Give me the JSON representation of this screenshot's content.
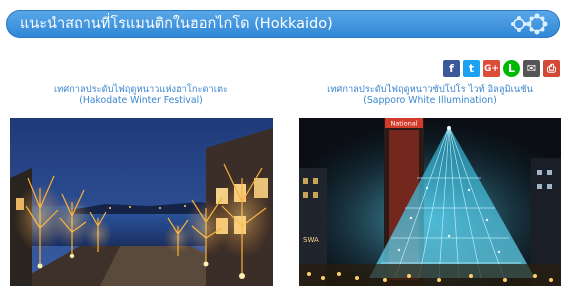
{
  "header": {
    "title": "แนะนำสถานที่โรแมนติกในฮอกไกโด (Hokkaido)",
    "decor_icon": "snowflake-icon"
  },
  "share": {
    "buttons": [
      {
        "name": "facebook",
        "glyph": "f",
        "color": "#3b5998"
      },
      {
        "name": "twitter",
        "glyph": "t",
        "color": "#1da1f2"
      },
      {
        "name": "google-plus",
        "glyph": "G+",
        "color": "#dd4b39"
      },
      {
        "name": "line",
        "glyph": "L",
        "color": "#00b900"
      },
      {
        "name": "email",
        "glyph": "✉",
        "color": "#555555"
      },
      {
        "name": "print",
        "glyph": "⎙",
        "color": "#d34836"
      }
    ]
  },
  "articles": [
    {
      "title_th": "เทศกาลประดับไฟฤดูหนาวแห่งฮาโกะดาเตะ",
      "title_en": "(Hakodate Winter Festival)"
    },
    {
      "title_th": "เทศกาลประดับไฟฤดูหนาวซัปโปโร ไวท์ อิลลูมิเนชัน",
      "title_en": "(Sapporo White Illumination)",
      "sign_text": "National",
      "building_text": "SWA"
    }
  ]
}
